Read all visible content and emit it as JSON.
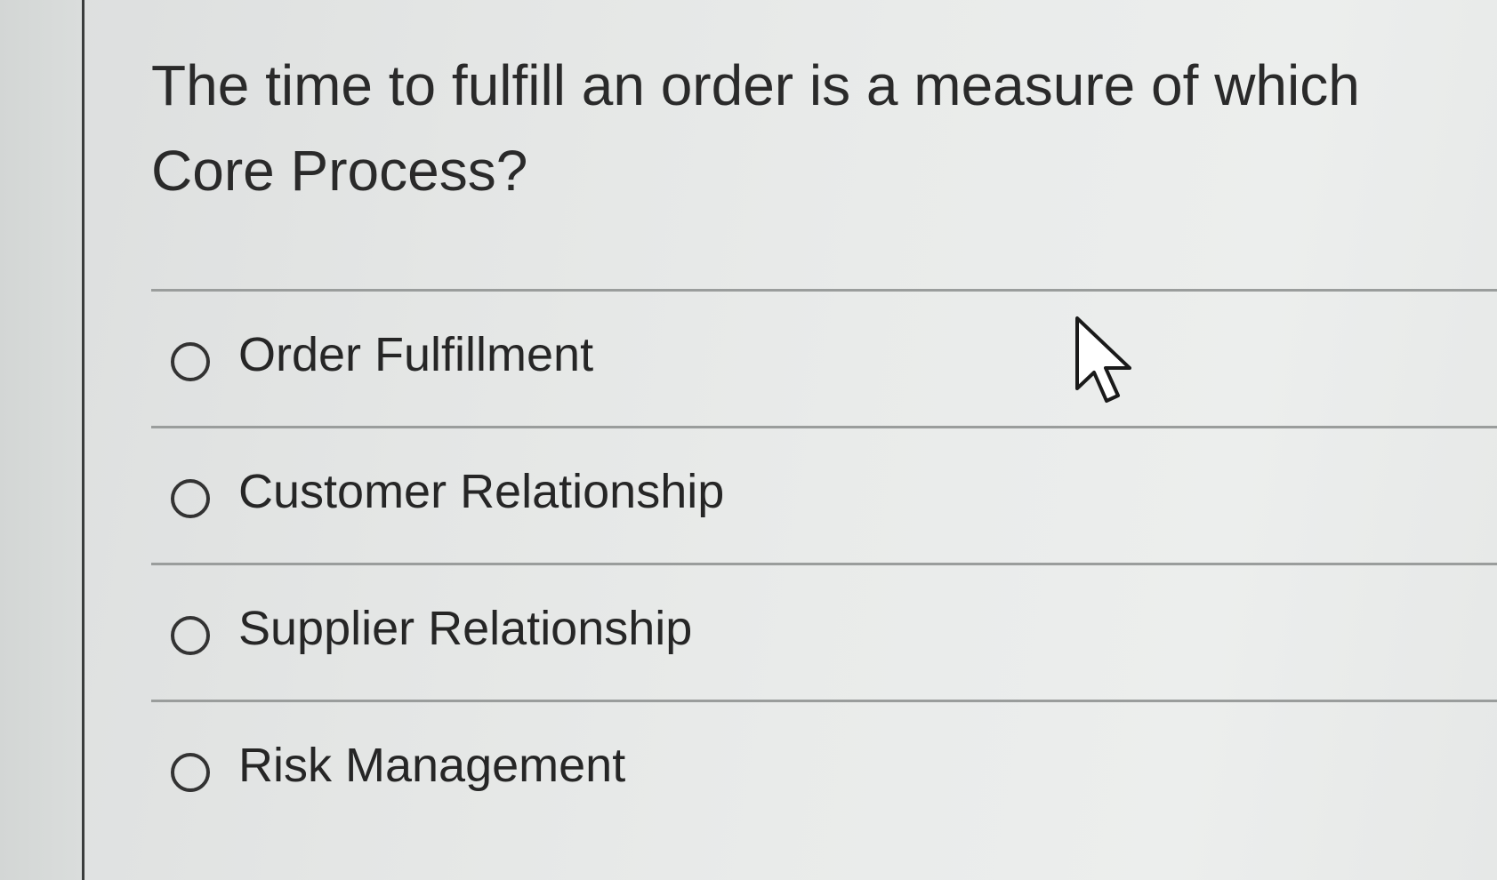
{
  "question": {
    "text": "The time to fulfill an order is a measure of which Core Process?"
  },
  "options": [
    {
      "label": "Order Fulfillment",
      "selected": false
    },
    {
      "label": "Customer Relationship",
      "selected": false
    },
    {
      "label": "Supplier Relationship",
      "selected": false
    },
    {
      "label": "Risk Management",
      "selected": false
    }
  ],
  "cursor": {
    "icon": "mouse-pointer-icon"
  },
  "colors": {
    "text": "#2a2a2a",
    "divider": "#9a9d9c",
    "left_border": "#3a3c3c",
    "background": "#e6e8e7"
  }
}
